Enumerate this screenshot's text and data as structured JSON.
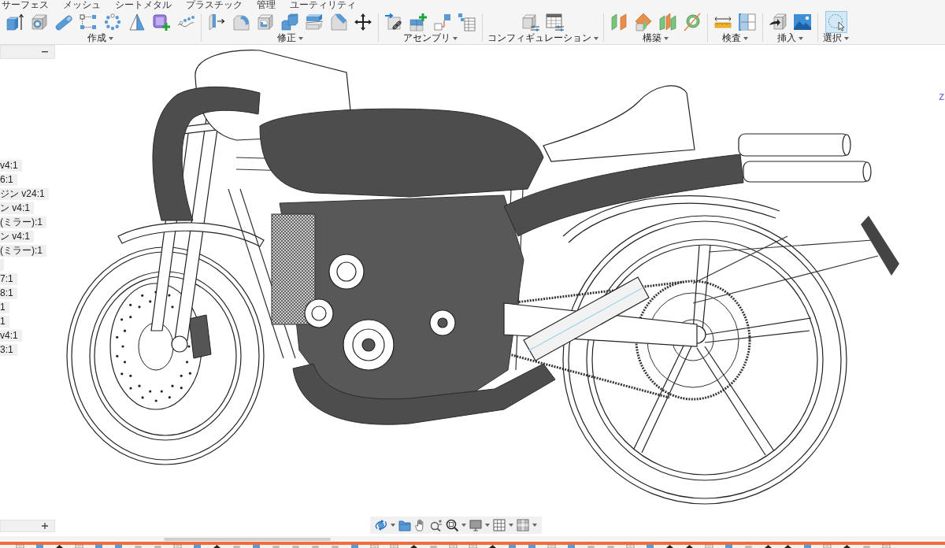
{
  "tabs": [
    {
      "label": "サーフェス",
      "selected": false
    },
    {
      "label": "メッシュ",
      "selected": false
    },
    {
      "label": "シートメタル",
      "selected": false
    },
    {
      "label": "プラスチック",
      "selected": false
    },
    {
      "label": "管理",
      "selected": false
    },
    {
      "label": "ユーティリティ",
      "selected": false
    }
  ],
  "toolbar": {
    "groups": [
      {
        "label": "作成",
        "tools": [
          {
            "active": false
          },
          {
            "active": false
          },
          {
            "active": false
          },
          {
            "active": false
          },
          {
            "active": false
          },
          {
            "active": false
          },
          {
            "active": false
          },
          {
            "active": false
          }
        ]
      },
      {
        "label": "修正",
        "tools": [
          {
            "active": false
          },
          {
            "active": false
          },
          {
            "active": false
          },
          {
            "active": false
          },
          {
            "active": false
          },
          {
            "active": false
          },
          {
            "active": false
          }
        ]
      },
      {
        "label": "アセンブリ",
        "tools": [
          {
            "active": false
          },
          {
            "active": false
          },
          {
            "active": false
          },
          {
            "active": false
          }
        ]
      },
      {
        "label": "コンフィギュレーション",
        "tools": [
          {
            "active": false
          },
          {
            "active": false
          }
        ]
      },
      {
        "label": "構築",
        "tools": [
          {
            "active": false
          },
          {
            "active": false
          },
          {
            "active": false
          },
          {
            "active": false
          }
        ]
      },
      {
        "label": "検査",
        "tools": [
          {
            "active": false
          },
          {
            "active": false
          }
        ]
      },
      {
        "label": "挿入",
        "tools": [
          {
            "active": false
          },
          {
            "active": false
          }
        ]
      },
      {
        "label": "選択",
        "tools": [
          {
            "active": true
          }
        ]
      }
    ]
  },
  "browser": {
    "items": [
      {
        "kind": "label",
        "label": "v4:1"
      },
      {
        "kind": "label",
        "label": "6:1"
      },
      {
        "kind": "label",
        "label": "ジン v24:1"
      },
      {
        "kind": "label",
        "label": "ン v4:1"
      },
      {
        "kind": "label",
        "label": "(ミラー):1"
      },
      {
        "kind": "label",
        "label": "ン v4:1"
      },
      {
        "kind": "label",
        "label": "(ミラー):1"
      },
      {
        "kind": "blank"
      },
      {
        "kind": "label",
        "label": "7:1"
      },
      {
        "kind": "label",
        "label": "8:1"
      },
      {
        "kind": "label",
        "label": "1"
      },
      {
        "kind": "label",
        "label": "1"
      },
      {
        "kind": "label",
        "label": "v4:1"
      },
      {
        "kind": "label",
        "label": "3:1"
      }
    ]
  },
  "viewcube": {
    "axis_label": "Z"
  }
}
